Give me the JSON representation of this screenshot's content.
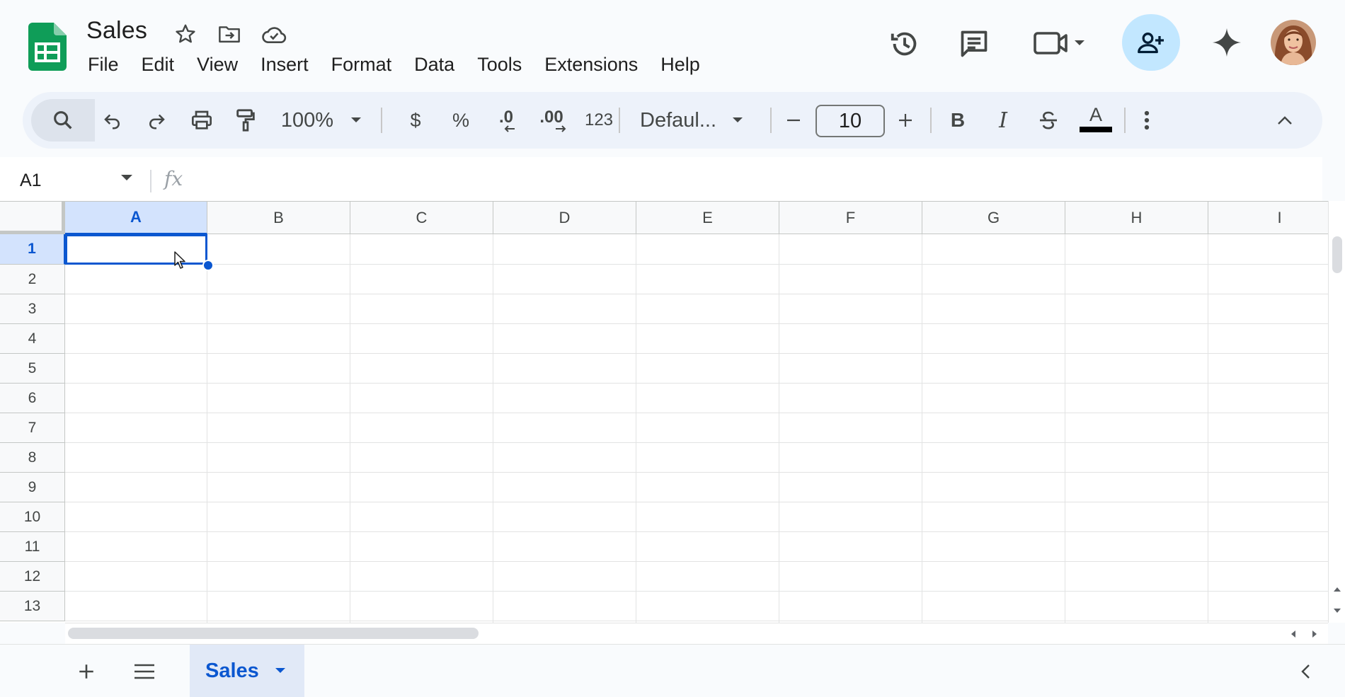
{
  "app": {
    "doc_title": "Sales"
  },
  "menu": [
    "File",
    "Edit",
    "View",
    "Insert",
    "Format",
    "Data",
    "Tools",
    "Extensions",
    "Help"
  ],
  "toolbar": {
    "zoom": "100%",
    "currency": "$",
    "percent": "%",
    "decrease_decimal": ".0",
    "increase_decimal": ".00",
    "number_format": "123",
    "font": "Defaul...",
    "font_size": "10",
    "bold": "B",
    "italic": "I",
    "text_color_letter": "A"
  },
  "formula_bar": {
    "name_box": "A1",
    "fx": "fx",
    "formula": ""
  },
  "grid": {
    "columns": [
      "A",
      "B",
      "C",
      "D",
      "E",
      "F",
      "G",
      "H",
      "I"
    ],
    "rows": [
      "1",
      "2",
      "3",
      "4",
      "5",
      "6",
      "7",
      "8",
      "9",
      "10",
      "11",
      "12",
      "13"
    ],
    "selected_cell": "A1"
  },
  "sheets": {
    "active_tab": "Sales"
  },
  "colors": {
    "accent": "#0b57d0",
    "share_bg": "#c2e7ff",
    "logo_green": "#0f9d58",
    "selection_bg": "#d3e3fd"
  },
  "icons": [
    "search-icon",
    "undo-icon",
    "redo-icon",
    "print-icon",
    "paint-format-icon",
    "history-icon",
    "comment-icon",
    "video-call-icon",
    "share-icon",
    "gemini-icon",
    "star-icon",
    "move-icon",
    "cloud-icon"
  ]
}
